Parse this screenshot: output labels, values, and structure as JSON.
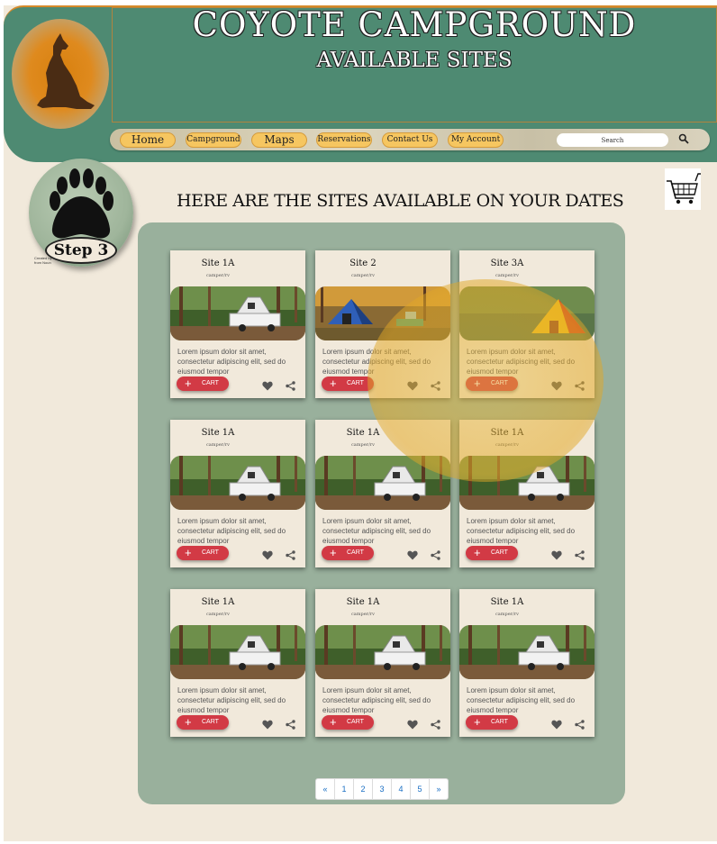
{
  "header": {
    "title": "COYOTE CAMPGROUND",
    "subtitle": "AVAILABLE SITES"
  },
  "nav": {
    "items": [
      "Home",
      "Campground",
      "Maps",
      "Reservations",
      "Contact Us",
      "My Account"
    ],
    "search_placeholder": "Search"
  },
  "step": {
    "label": "Step 3",
    "credit_line1": "Created by",
    "credit_line2": "from Noun"
  },
  "main": {
    "heading": "HERE ARE THE SITES AVAILABLE ON YOUR DATES"
  },
  "cards": [
    {
      "title": "Site 1A",
      "subtitle": "camper/rv",
      "image": "camper-trailer",
      "text": "Lorem ipsum dolor sit amet, consectetur adipiscing elit, sed do eiusmod tempor",
      "cart_label": "CART"
    },
    {
      "title": "Site 2",
      "subtitle": "camper/rv",
      "image": "blue-tent",
      "text": "Lorem ipsum dolor sit amet, consectetur adipiscing elit, sed do eiusmod tempor",
      "cart_label": "CART"
    },
    {
      "title": "Site 3A",
      "subtitle": "camper/rv",
      "image": "yellow-tent",
      "text": "Lorem ipsum dolor sit amet, consectetur adipiscing elit, sed do eiusmod tempor",
      "cart_label": "CART"
    },
    {
      "title": "Site 1A",
      "subtitle": "camper/rv",
      "image": "camper-trailer",
      "text": "Lorem ipsum dolor sit amet, consectetur adipiscing elit, sed do eiusmod tempor",
      "cart_label": "CART"
    },
    {
      "title": "Site 1A",
      "subtitle": "camper/rv",
      "image": "camper-trailer",
      "text": "Lorem ipsum dolor sit amet, consectetur adipiscing elit, sed do eiusmod tempor",
      "cart_label": "CART"
    },
    {
      "title": "Site 1A",
      "subtitle": "camper/rv",
      "image": "camper-trailer",
      "text": "Lorem ipsum dolor sit amet, consectetur adipiscing elit, sed do eiusmod tempor",
      "cart_label": "CART"
    },
    {
      "title": "Site 1A",
      "subtitle": "camper/rv",
      "image": "camper-trailer",
      "text": "Lorem ipsum dolor sit amet, consectetur adipiscing elit, sed do eiusmod tempor",
      "cart_label": "CART"
    },
    {
      "title": "Site 1A",
      "subtitle": "camper/rv",
      "image": "camper-trailer",
      "text": "Lorem ipsum dolor sit amet, consectetur adipiscing elit, sed do eiusmod tempor",
      "cart_label": "CART"
    },
    {
      "title": "Site 1A",
      "subtitle": "camper/rv",
      "image": "camper-trailer",
      "text": "Lorem ipsum dolor sit amet, consectetur adipiscing elit, sed do eiusmod tempor",
      "cart_label": "CART"
    }
  ],
  "pagination": [
    "«",
    "1",
    "2",
    "3",
    "4",
    "5",
    "»"
  ],
  "icons": {
    "logo": "howling-coyote-icon",
    "step": "paw-print-icon",
    "cart": "shopping-cart-icon",
    "search": "search-icon",
    "favorite": "heart-icon",
    "share": "share-icon"
  },
  "colors": {
    "header_bg": "#4e8a72",
    "page_bg": "#f1e9db",
    "nav_button": "#f6c660",
    "panel_bg": "#99b09c",
    "cart_button": "#d23a45",
    "link": "#1a6fc4"
  }
}
